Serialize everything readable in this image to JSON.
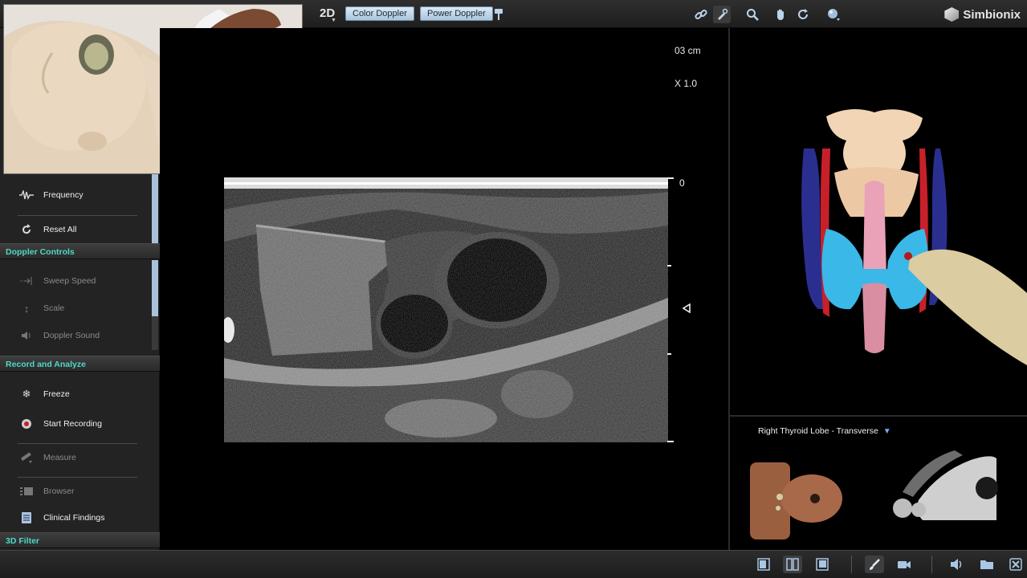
{
  "toolbar": {
    "mode": "2D",
    "color_doppler": "Color Doppler",
    "power_doppler": "Power Doppler",
    "brand": "Simbionix"
  },
  "left_panel": {
    "items_top": [
      {
        "label": "Frequency",
        "icon": "waveform-icon"
      },
      {
        "label": "Reset All",
        "icon": "reset-icon"
      }
    ],
    "doppler_header": "Doppler Controls",
    "doppler_items": [
      {
        "label": "Sweep Speed",
        "icon": "sweep-icon"
      },
      {
        "label": "Scale",
        "icon": "scale-icon"
      },
      {
        "label": "Doppler Sound",
        "icon": "speaker-icon"
      }
    ],
    "record_header": "Record and Analyze",
    "record_items": [
      {
        "label": "Freeze",
        "icon": "snowflake-icon"
      },
      {
        "label": "Start Recording",
        "icon": "record-icon"
      },
      {
        "label": "Measure",
        "icon": "ruler-icon"
      },
      {
        "label": "Browser",
        "icon": "browser-icon"
      },
      {
        "label": "Clinical Findings",
        "icon": "clipboard-icon"
      }
    ],
    "filter_header": "3D Filter"
  },
  "ultrasound": {
    "depth": "03 cm",
    "zoom": "X 1.0",
    "depth_zero": "0"
  },
  "orientation": {
    "view": "Right Thyroid Lobe - Transverse"
  },
  "colors": {
    "accent": "#4ed8c6",
    "button": "#a9c4dc",
    "vessel_red": "#c8202a",
    "vessel_blue": "#2a2f8f",
    "thyroid": "#3ab8e8"
  }
}
